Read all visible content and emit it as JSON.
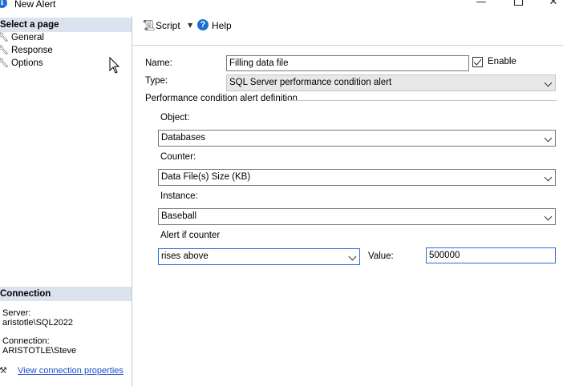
{
  "window": {
    "title": "New Alert",
    "minimize": "—",
    "close": "✕"
  },
  "left_pane": {
    "select_page_header": "Select a page",
    "pages": [
      {
        "label": "General",
        "icon": "wrench-icon"
      },
      {
        "label": "Response",
        "icon": "wrench-icon"
      },
      {
        "label": "Options",
        "icon": "wrench-icon"
      }
    ],
    "connection_header": "Connection",
    "server_label": "Server:",
    "server_value": "aristotle\\SQL2022",
    "connection_label": "Connection:",
    "connection_value": "ARISTOTLE\\Steve",
    "view_properties_link": "View connection properties"
  },
  "toolbar": {
    "script_label": "Script",
    "help_label": "Help"
  },
  "form": {
    "name_label": "Name:",
    "name_value": "Filling data file",
    "enable_label": "Enable",
    "enable_checked": true,
    "type_label": "Type:",
    "type_value": "SQL Server performance condition alert",
    "group_title": "Performance condition alert definition",
    "object_label": "Object:",
    "object_value": "Databases",
    "counter_label": "Counter:",
    "counter_value": "Data File(s) Size (KB)",
    "instance_label": "Instance:",
    "instance_value": "Baseball",
    "alert_if_label": "Alert if counter",
    "alert_if_value": "rises above",
    "value_label": "Value:",
    "value_value": "500000"
  },
  "colors": {
    "header_bg": "#dbe4ee",
    "link": "#1a4fc8",
    "focus_border": "#2c6ed5",
    "help_icon": "#1c6fd1"
  }
}
